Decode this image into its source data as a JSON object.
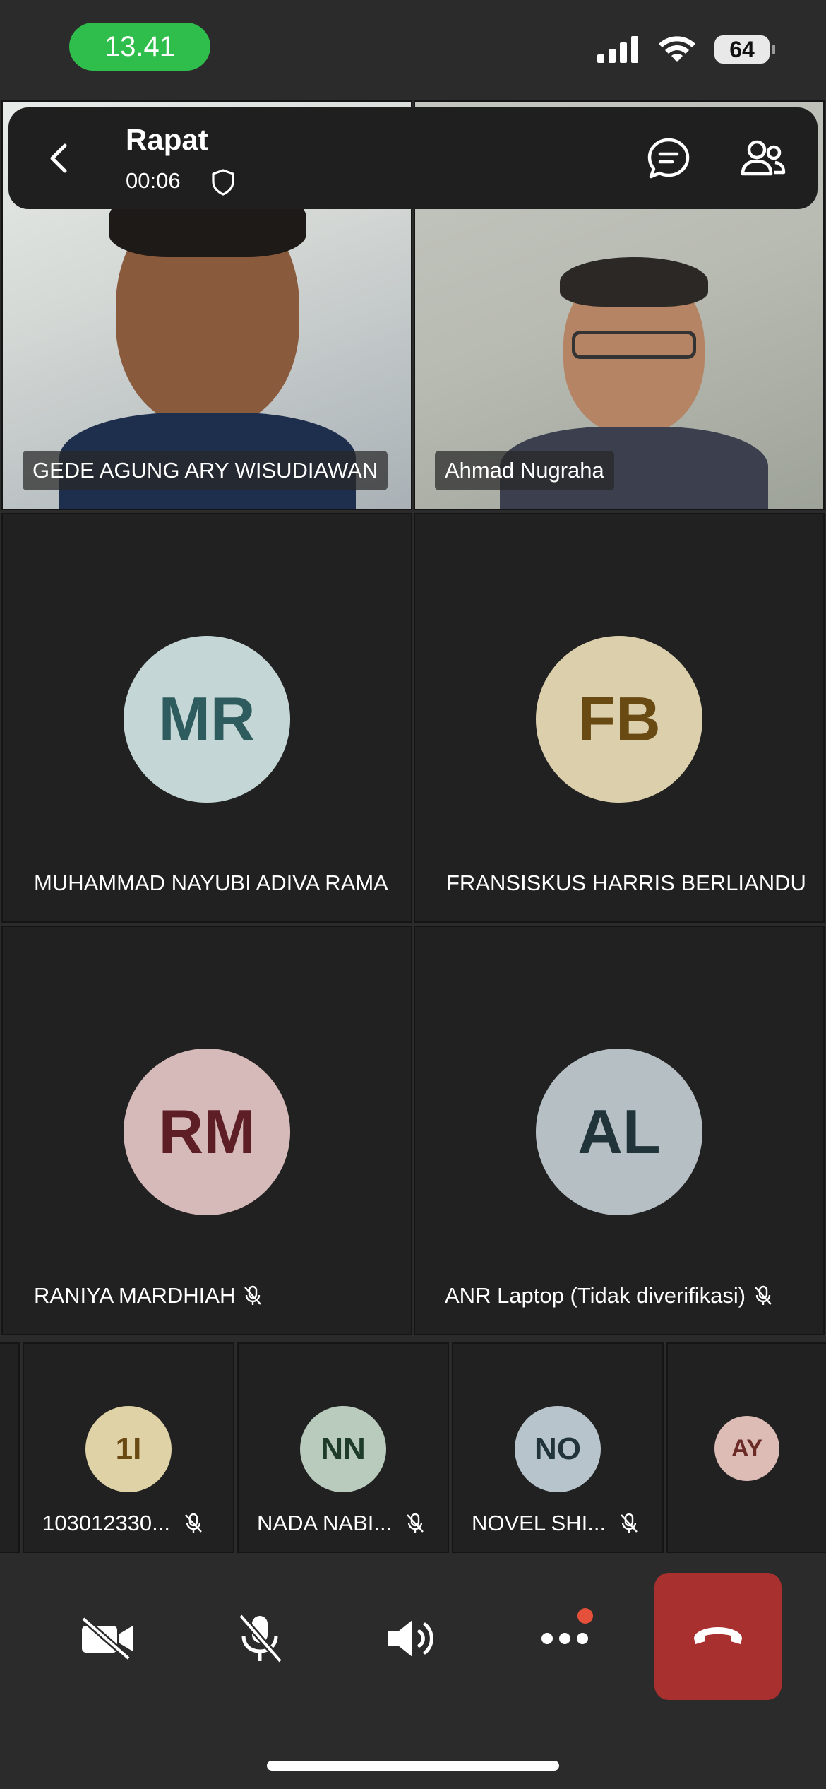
{
  "status_bar": {
    "time": "13.41",
    "battery": "64"
  },
  "header": {
    "title": "Rapat",
    "timer": "00:06"
  },
  "video_tiles": [
    {
      "name": "GEDE AGUNG ARY WISUDIAWAN"
    },
    {
      "name": "Ahmad Nugraha"
    }
  ],
  "avatar_tiles": [
    {
      "initials": "MR",
      "name": "MUHAMMAD NAYUBI ADIVA RAMA",
      "color": "#c4d7d6",
      "text_color": "#2e5c5e",
      "muted": false
    },
    {
      "initials": "FB",
      "name": "FRANSISKUS HARRIS BERLIANDU",
      "color": "#dccfac",
      "text_color": "#6a4a13",
      "muted": false
    },
    {
      "initials": "RM",
      "name": "RANIYA MARDHIAH",
      "color": "#d6b9b9",
      "text_color": "#5d1e25",
      "muted": true
    },
    {
      "initials": "AL",
      "name": "ANR Laptop (Tidak diverifikasi)",
      "color": "#b6c0c4",
      "text_color": "#21343a",
      "muted": true
    }
  ],
  "small_tiles": [
    {
      "initials": "1I",
      "name": "103012330...",
      "color": "#dfd2a6",
      "text_color": "#6a4a13",
      "muted": true
    },
    {
      "initials": "NN",
      "name": "NADA NABI...",
      "color": "#b9cbbd",
      "text_color": "#1f3b2a",
      "muted": true
    },
    {
      "initials": "NO",
      "name": "NOVEL SHI...",
      "color": "#b8c4cb",
      "text_color": "#21343a",
      "muted": true
    },
    {
      "initials": "AY",
      "name": "",
      "color": "#ddbcb6",
      "text_color": "#6a2a26",
      "muted": false
    }
  ],
  "toolbar": {
    "camera": "camera-off-icon",
    "mic": "mic-off-icon",
    "speaker": "speaker-icon",
    "more": "more-icon",
    "end": "end-call-icon",
    "end_color": "#a8302f",
    "badge_color": "#e5503a"
  }
}
